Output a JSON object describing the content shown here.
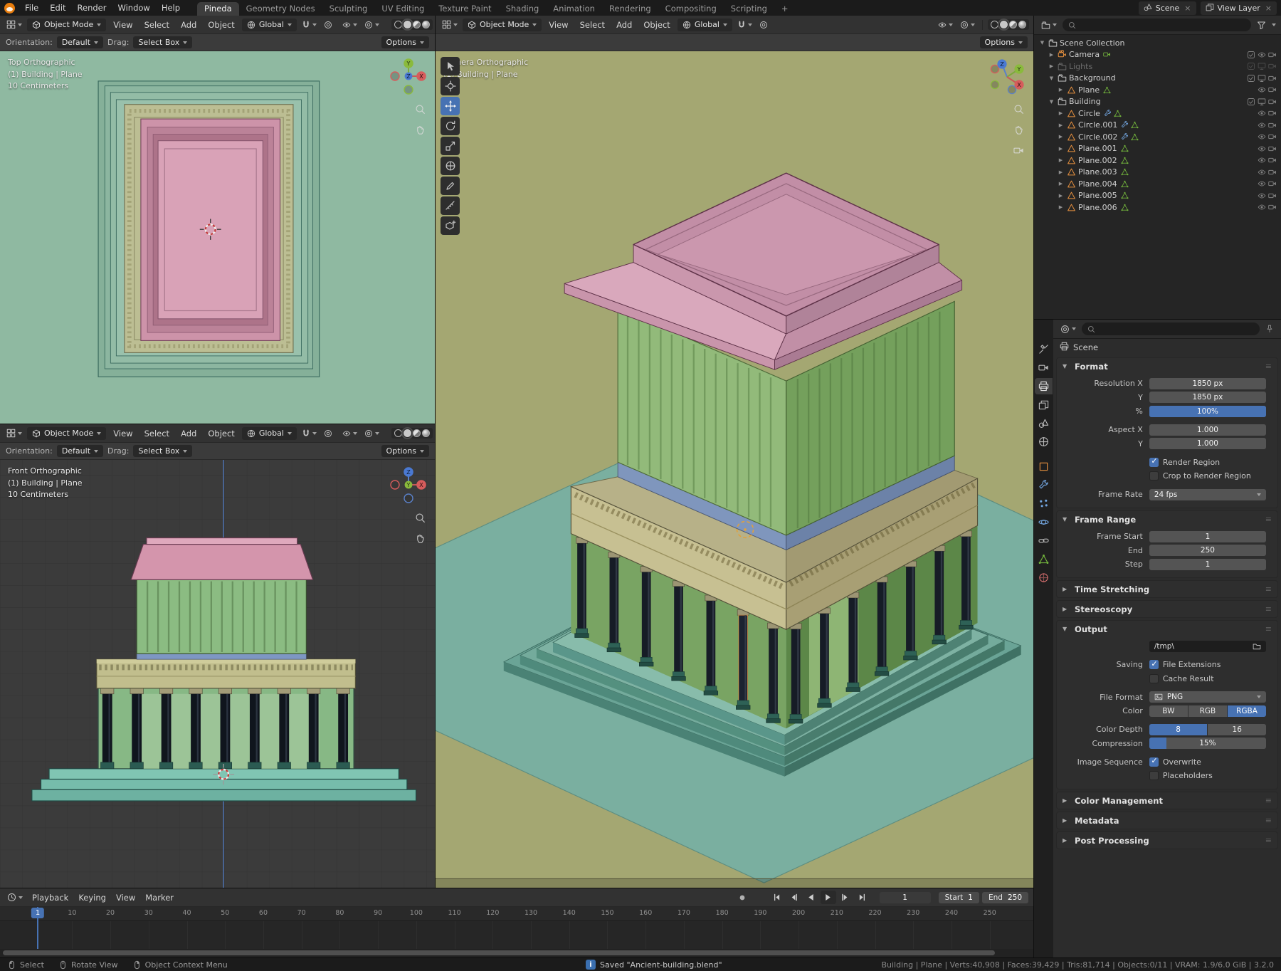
{
  "colors": {
    "accent": "#4772b3",
    "viewport_top_bg": "#8fb9a1",
    "viewport_front_bg": "#3b3b3b",
    "viewport_camera_bg": "#a4a772",
    "ground_plane_teal": "#7aafa0",
    "roof_pink": "#c28ea6",
    "wall_green": "#92ba7a",
    "entablature_khaki": "#c7c092",
    "platform_teal": "#88bcab"
  },
  "topbar": {
    "menus": [
      "File",
      "Edit",
      "Render",
      "Window",
      "Help"
    ],
    "tabs": [
      "Pineda",
      "Geometry Nodes",
      "Sculpting",
      "UV Editing",
      "Texture Paint",
      "Shading",
      "Animation",
      "Rendering",
      "Compositing",
      "Scripting"
    ],
    "active_tab": "Pineda",
    "add_tab": "+",
    "scene_label": "Scene",
    "view_layer_label": "View Layer"
  },
  "viewport_chrome": {
    "mode": "Object Mode",
    "menus": [
      "View",
      "Select",
      "Add",
      "Object"
    ],
    "transform_orientation": "Global",
    "header_icons": [
      "editor-type",
      "snapping-magnet",
      "proportional-edit",
      "show-gizmos",
      "show-overlays",
      "shading-wireframe",
      "shading-solid",
      "shading-material",
      "shading-rendered"
    ],
    "tool_settings": {
      "orientation_label": "Orientation:",
      "orientation_value": "Default",
      "drag_label": "Drag:",
      "drag_value": "Select Box",
      "options_label": "Options"
    }
  },
  "viewports": {
    "top": {
      "line1": "Top Orthographic",
      "line2": "(1) Building | Plane",
      "line3": "10 Centimeters"
    },
    "front": {
      "line1": "Front Orthographic",
      "line2": "(1) Building | Plane",
      "line3": "10 Centimeters"
    },
    "camera": {
      "line1": "Camera Orthographic",
      "line2": "(1) Building | Plane"
    }
  },
  "toolbar": {
    "tools": [
      "select-box",
      "cursor",
      "move",
      "rotate",
      "scale",
      "transform",
      "annotate",
      "measure",
      "add-primitive"
    ],
    "active": "move"
  },
  "outliner": {
    "search_placeholder": "",
    "rows": [
      {
        "label": "Scene Collection",
        "icon": "collection",
        "level": 0,
        "caret": "▼",
        "toggles": []
      },
      {
        "label": "Camera",
        "icon": "camObj",
        "level": 1,
        "caret": "▶",
        "dataicon": "camData",
        "toggles": [
          "check",
          "eye",
          "cam"
        ]
      },
      {
        "label": "Lights",
        "icon": "collection",
        "level": 1,
        "caret": "▶",
        "muted": true,
        "toggles": [
          "check",
          "screen",
          "cam"
        ]
      },
      {
        "label": "Background",
        "icon": "collection",
        "level": 1,
        "caret": "▼",
        "toggles": [
          "check",
          "screen",
          "cam"
        ]
      },
      {
        "label": "Plane",
        "icon": "meshObj",
        "level": 2,
        "caret": "▶",
        "dataicon": "mesh",
        "toggles": [
          "eye",
          "cam"
        ]
      },
      {
        "label": "Building",
        "icon": "collection",
        "level": 1,
        "caret": "▼",
        "toggles": [
          "check",
          "screen",
          "cam"
        ]
      },
      {
        "label": "Circle",
        "icon": "meshObj",
        "level": 2,
        "caret": "▶",
        "mod": true,
        "dataicon": "mesh",
        "toggles": [
          "eye",
          "cam"
        ]
      },
      {
        "label": "Circle.001",
        "icon": "meshObj",
        "level": 2,
        "caret": "▶",
        "mod": true,
        "dataicon": "mesh",
        "toggles": [
          "eye",
          "cam"
        ]
      },
      {
        "label": "Circle.002",
        "icon": "meshObj",
        "level": 2,
        "caret": "▶",
        "mod": true,
        "dataicon": "mesh",
        "toggles": [
          "eye",
          "cam"
        ]
      },
      {
        "label": "Plane.001",
        "icon": "meshObj",
        "level": 2,
        "caret": "▶",
        "dataicon": "mesh",
        "toggles": [
          "eye",
          "cam"
        ]
      },
      {
        "label": "Plane.002",
        "icon": "meshObj",
        "level": 2,
        "caret": "▶",
        "dataicon": "mesh",
        "toggles": [
          "eye",
          "cam"
        ]
      },
      {
        "label": "Plane.003",
        "icon": "meshObj",
        "level": 2,
        "caret": "▶",
        "dataicon": "mesh",
        "toggles": [
          "eye",
          "cam"
        ]
      },
      {
        "label": "Plane.004",
        "icon": "meshObj",
        "level": 2,
        "caret": "▶",
        "dataicon": "mesh",
        "toggles": [
          "eye",
          "cam"
        ]
      },
      {
        "label": "Plane.005",
        "icon": "meshObj",
        "level": 2,
        "caret": "▶",
        "dataicon": "mesh",
        "toggles": [
          "eye",
          "cam"
        ]
      },
      {
        "label": "Plane.006",
        "icon": "meshObj",
        "level": 2,
        "caret": "▶",
        "dataicon": "mesh",
        "toggles": [
          "eye",
          "cam"
        ]
      }
    ]
  },
  "properties": {
    "breadcrumb": "Scene",
    "active_tab": "output",
    "tabs": [
      {
        "name": "tool",
        "icon": "toolIc",
        "color": "#b8b8b8"
      },
      {
        "name": "render",
        "icon": "camToggle",
        "color": "#b8b8b8"
      },
      {
        "name": "output",
        "icon": "printer",
        "color": "#e0e0e0"
      },
      {
        "name": "view-layer",
        "icon": "layers",
        "color": "#b8b8b8"
      },
      {
        "name": "scene",
        "icon": "sceneIc",
        "color": "#b8b8b8"
      },
      {
        "name": "world",
        "icon": "world",
        "color": "#b8b8b8"
      },
      {
        "name": "object",
        "icon": "objectIc",
        "color": "#e8913f"
      },
      {
        "name": "modifiers",
        "icon": "wrench",
        "color": "#71a3dc"
      },
      {
        "name": "particles",
        "icon": "dots",
        "color": "#71a3dc"
      },
      {
        "name": "physics",
        "icon": "physics",
        "color": "#71a3dc"
      },
      {
        "name": "constraints",
        "icon": "link",
        "color": "#b8b8b8"
      },
      {
        "name": "data",
        "icon": "meshTri",
        "color": "#72b33c"
      },
      {
        "name": "material",
        "icon": "ballMat",
        "color": "#d87070"
      }
    ],
    "sections": [
      {
        "title": "Format",
        "state": "open",
        "rows": [
          {
            "label": "Resolution X",
            "widget": "field",
            "value": "1850 px"
          },
          {
            "label": "Y",
            "widget": "field",
            "value": "1850 px"
          },
          {
            "label": "%",
            "widget": "slider",
            "value": "100%",
            "fill": 1.0
          },
          {
            "label": "Aspect X",
            "widget": "field",
            "value": "1.000",
            "gap": true
          },
          {
            "label": "Y",
            "widget": "field",
            "value": "1.000"
          },
          {
            "label": "",
            "widget": "check",
            "value": "Render Region",
            "checked": true,
            "gap": true
          },
          {
            "label": "",
            "widget": "check",
            "value": "Crop to Render Region",
            "checked": false
          },
          {
            "label": "Frame Rate",
            "widget": "dropdown",
            "value": "24 fps",
            "gap": true
          }
        ]
      },
      {
        "title": "Frame Range",
        "state": "open",
        "rows": [
          {
            "label": "Frame Start",
            "widget": "field",
            "value": "1"
          },
          {
            "label": "End",
            "widget": "field",
            "value": "250"
          },
          {
            "label": "Step",
            "widget": "field",
            "value": "1"
          }
        ]
      },
      {
        "title": "Time Stretching",
        "state": "collapsed",
        "rows": []
      },
      {
        "title": "Stereoscopy",
        "state": "collapsed",
        "rows": []
      },
      {
        "title": "Output",
        "state": "open",
        "rows": [
          {
            "label": "",
            "widget": "path",
            "value": "/tmp\\"
          },
          {
            "label": "Saving",
            "widget": "check",
            "value": "File Extensions",
            "checked": true,
            "gap": true
          },
          {
            "label": "",
            "widget": "check",
            "value": "Cache Result",
            "checked": false
          },
          {
            "label": "File Format",
            "widget": "dropdown",
            "value": "PNG",
            "icon": "imageIc",
            "gap": true
          },
          {
            "label": "Color",
            "widget": "segmented",
            "options": [
              "BW",
              "RGB",
              "RGBA"
            ],
            "active": "RGBA"
          },
          {
            "label": "Color Depth",
            "widget": "segmented",
            "options": [
              "8",
              "16"
            ],
            "active": "8",
            "gap": true
          },
          {
            "label": "Compression",
            "widget": "slider",
            "value": "15%",
            "fill": 0.15
          },
          {
            "label": "Image Sequence",
            "widget": "check",
            "value": "Overwrite",
            "checked": true,
            "gap": true
          },
          {
            "label": "",
            "widget": "check",
            "value": "Placeholders",
            "checked": false
          }
        ]
      },
      {
        "title": "Color Management",
        "state": "collapsed",
        "rows": []
      },
      {
        "title": "Metadata",
        "state": "collapsed",
        "rows": []
      },
      {
        "title": "Post Processing",
        "state": "collapsed",
        "rows": []
      }
    ]
  },
  "timeline": {
    "menus": [
      "Playback",
      "Keying",
      "View",
      "Marker"
    ],
    "transport": [
      "jump-start",
      "jump-prev-keyframe",
      "play-reverse",
      "play",
      "jump-next-keyframe",
      "jump-end"
    ],
    "current_frame": "1",
    "start_label": "Start",
    "start_value": "1",
    "end_label": "End",
    "end_value": "250",
    "ticks": [
      10,
      20,
      30,
      40,
      50,
      60,
      70,
      80,
      90,
      100,
      110,
      120,
      130,
      140,
      150,
      160,
      170,
      180,
      190,
      200,
      210,
      220,
      230,
      240,
      250
    ]
  },
  "statusbar": {
    "hints": [
      {
        "button": "left",
        "label": "Select"
      },
      {
        "button": "middle",
        "label": "Rotate View"
      },
      {
        "button": "right",
        "label": "Object Context Menu"
      }
    ],
    "message": "Saved \"Ancient-building.blend\"",
    "stats": "Building | Plane | Verts:40,908 | Faces:39,429 | Tris:81,714 | Objects:0/11 | VRAM: 1.9/6.0 GiB | 3.2.0"
  }
}
